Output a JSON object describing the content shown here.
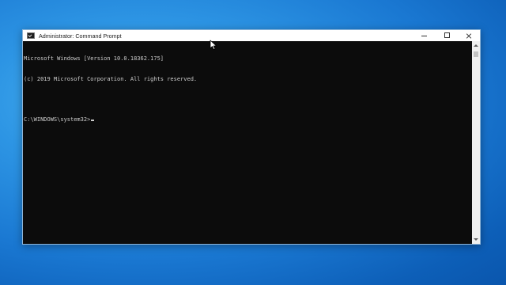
{
  "window": {
    "title": "Administrator: Command Prompt",
    "icon": "cmd-icon"
  },
  "console": {
    "lines": [
      "Microsoft Windows [Version 10.0.18362.175]",
      "(c) 2019 Microsoft Corporation. All rights reserved.",
      "",
      "C:\\WINDOWS\\system32>"
    ],
    "background": "#0c0c0c",
    "foreground": "#cccccc"
  },
  "colors": {
    "desktop": "#1a78d2",
    "titlebar": "#ffffff"
  }
}
